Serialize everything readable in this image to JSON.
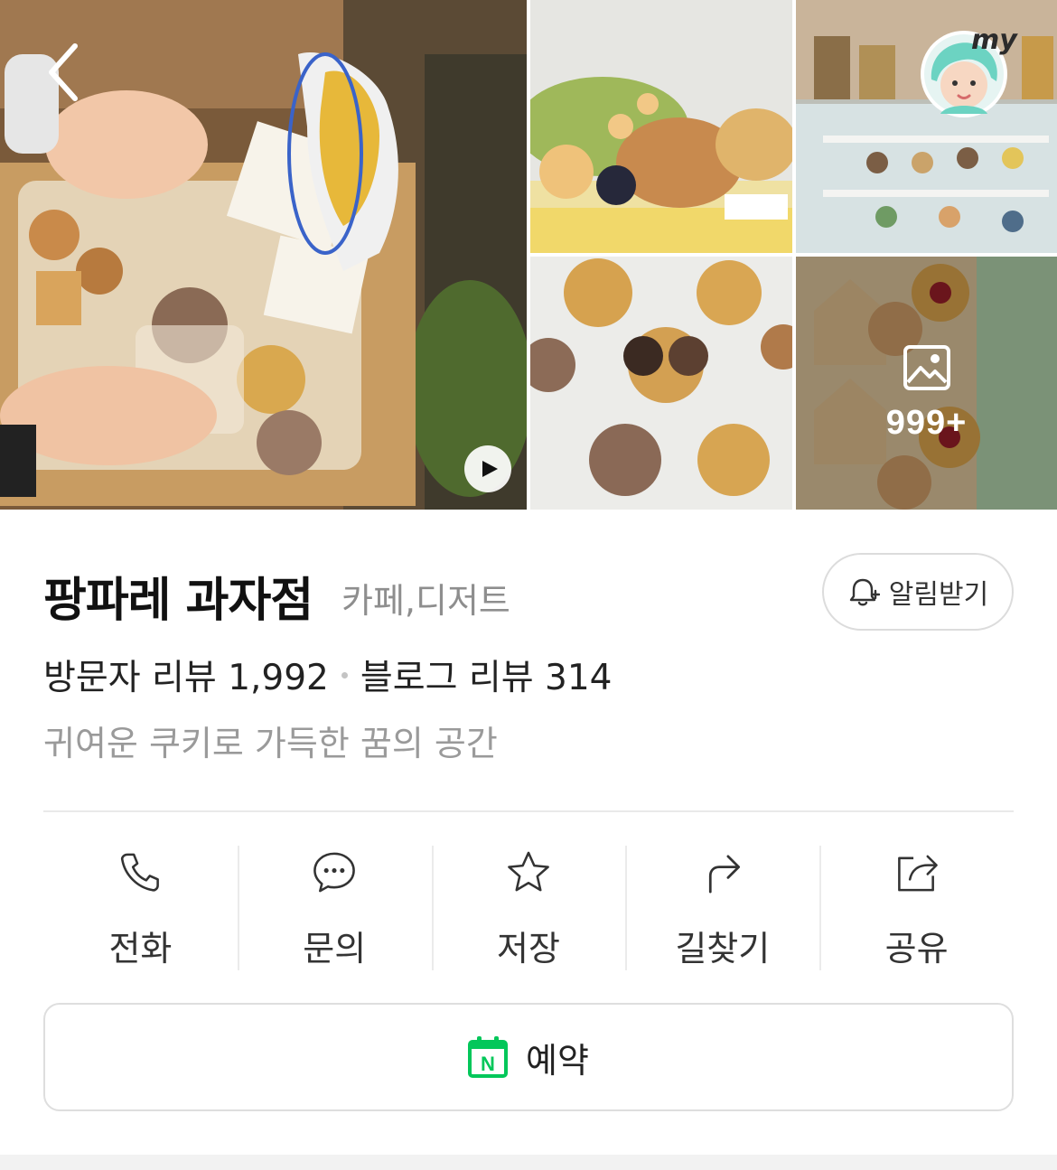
{
  "gallery": {
    "photos": [
      {
        "alt": "cookie-bags-photo"
      },
      {
        "alt": "cat-cookie-cake-photo"
      },
      {
        "alt": "bakery-showcase-photo"
      },
      {
        "alt": "dog-cookies-photo"
      },
      {
        "alt": "house-cookies-photo"
      }
    ],
    "more_count": "999+",
    "main_is_video": true,
    "avatar_badge": "my"
  },
  "place": {
    "name": "팡파레 과자점",
    "category": "카페,디저트",
    "alarm_label": "알림받기",
    "visitor_reviews_label": "방문자 리뷰 1,992",
    "blog_reviews_label": "블로그 리뷰 314",
    "tagline": "귀여운 쿠키로 가득한 꿈의 공간"
  },
  "actions": [
    {
      "label": "전화",
      "icon": "phone-icon"
    },
    {
      "label": "문의",
      "icon": "chat-icon"
    },
    {
      "label": "저장",
      "icon": "star-icon"
    },
    {
      "label": "길찾기",
      "icon": "directions-icon"
    },
    {
      "label": "공유",
      "icon": "share-icon"
    }
  ],
  "reserve": {
    "label": "예약",
    "icon": "naver-booking-icon",
    "icon_letter": "N"
  },
  "colors": {
    "naver_green": "#03C75A",
    "text_primary": "#111111",
    "text_muted": "#8e8e8e",
    "border": "#dcdcdc"
  }
}
